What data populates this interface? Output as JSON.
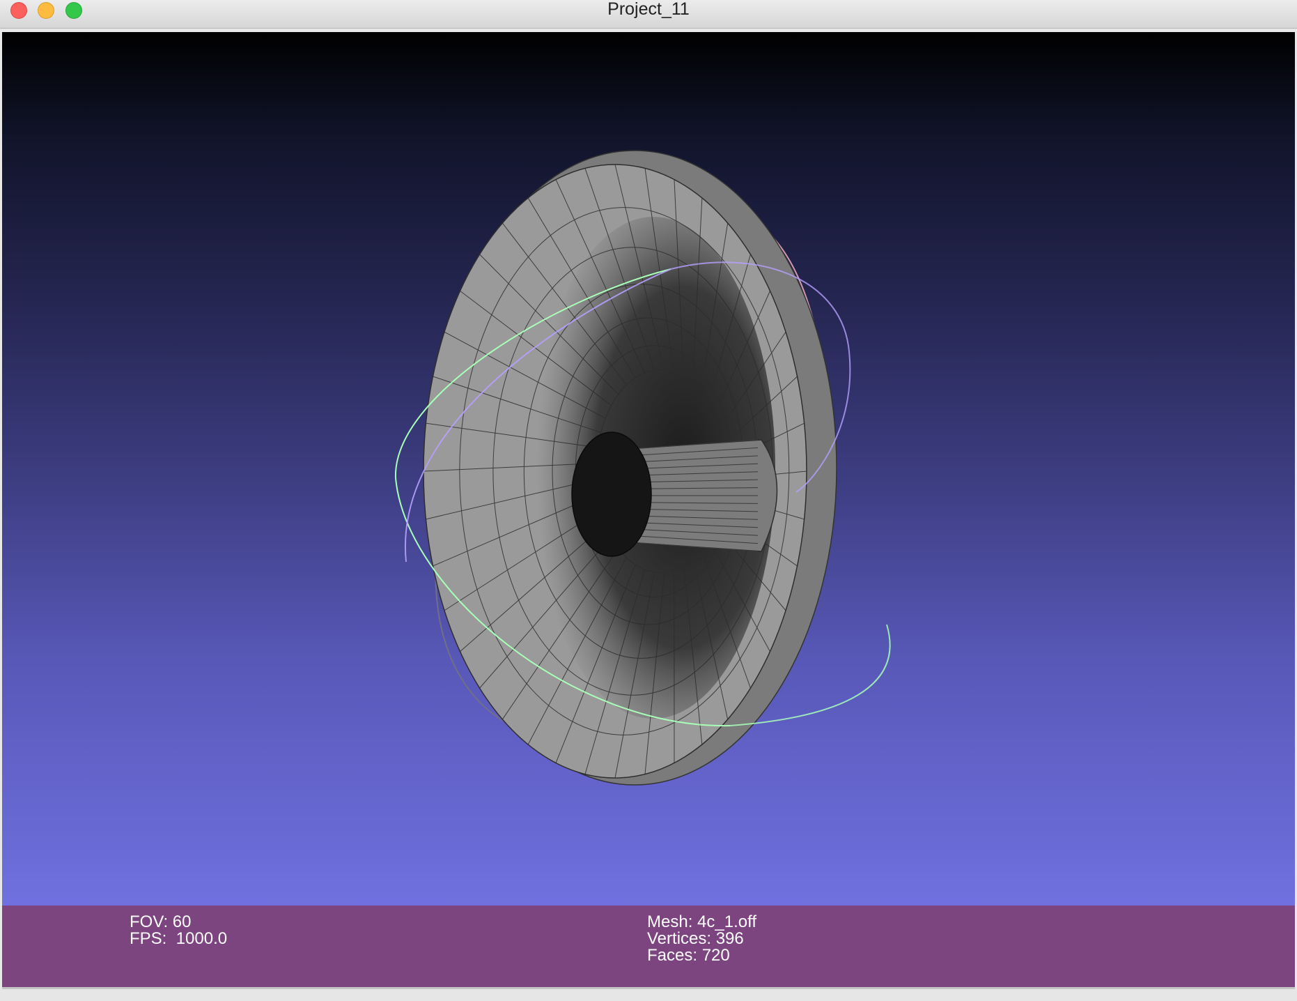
{
  "window": {
    "title": "Project_11"
  },
  "viewer": {
    "mesh_color": "#8a8a8a",
    "trackball_colors": [
      "#b7a0ff",
      "#a8ffb8",
      "#ffb6c8"
    ]
  },
  "stats": {
    "fov": "FOV: 60",
    "fps": "FPS:  1000.0",
    "mesh": "Mesh: 4c_1.off",
    "vertices": "Vertices: 396",
    "faces": "Faces: 720"
  }
}
